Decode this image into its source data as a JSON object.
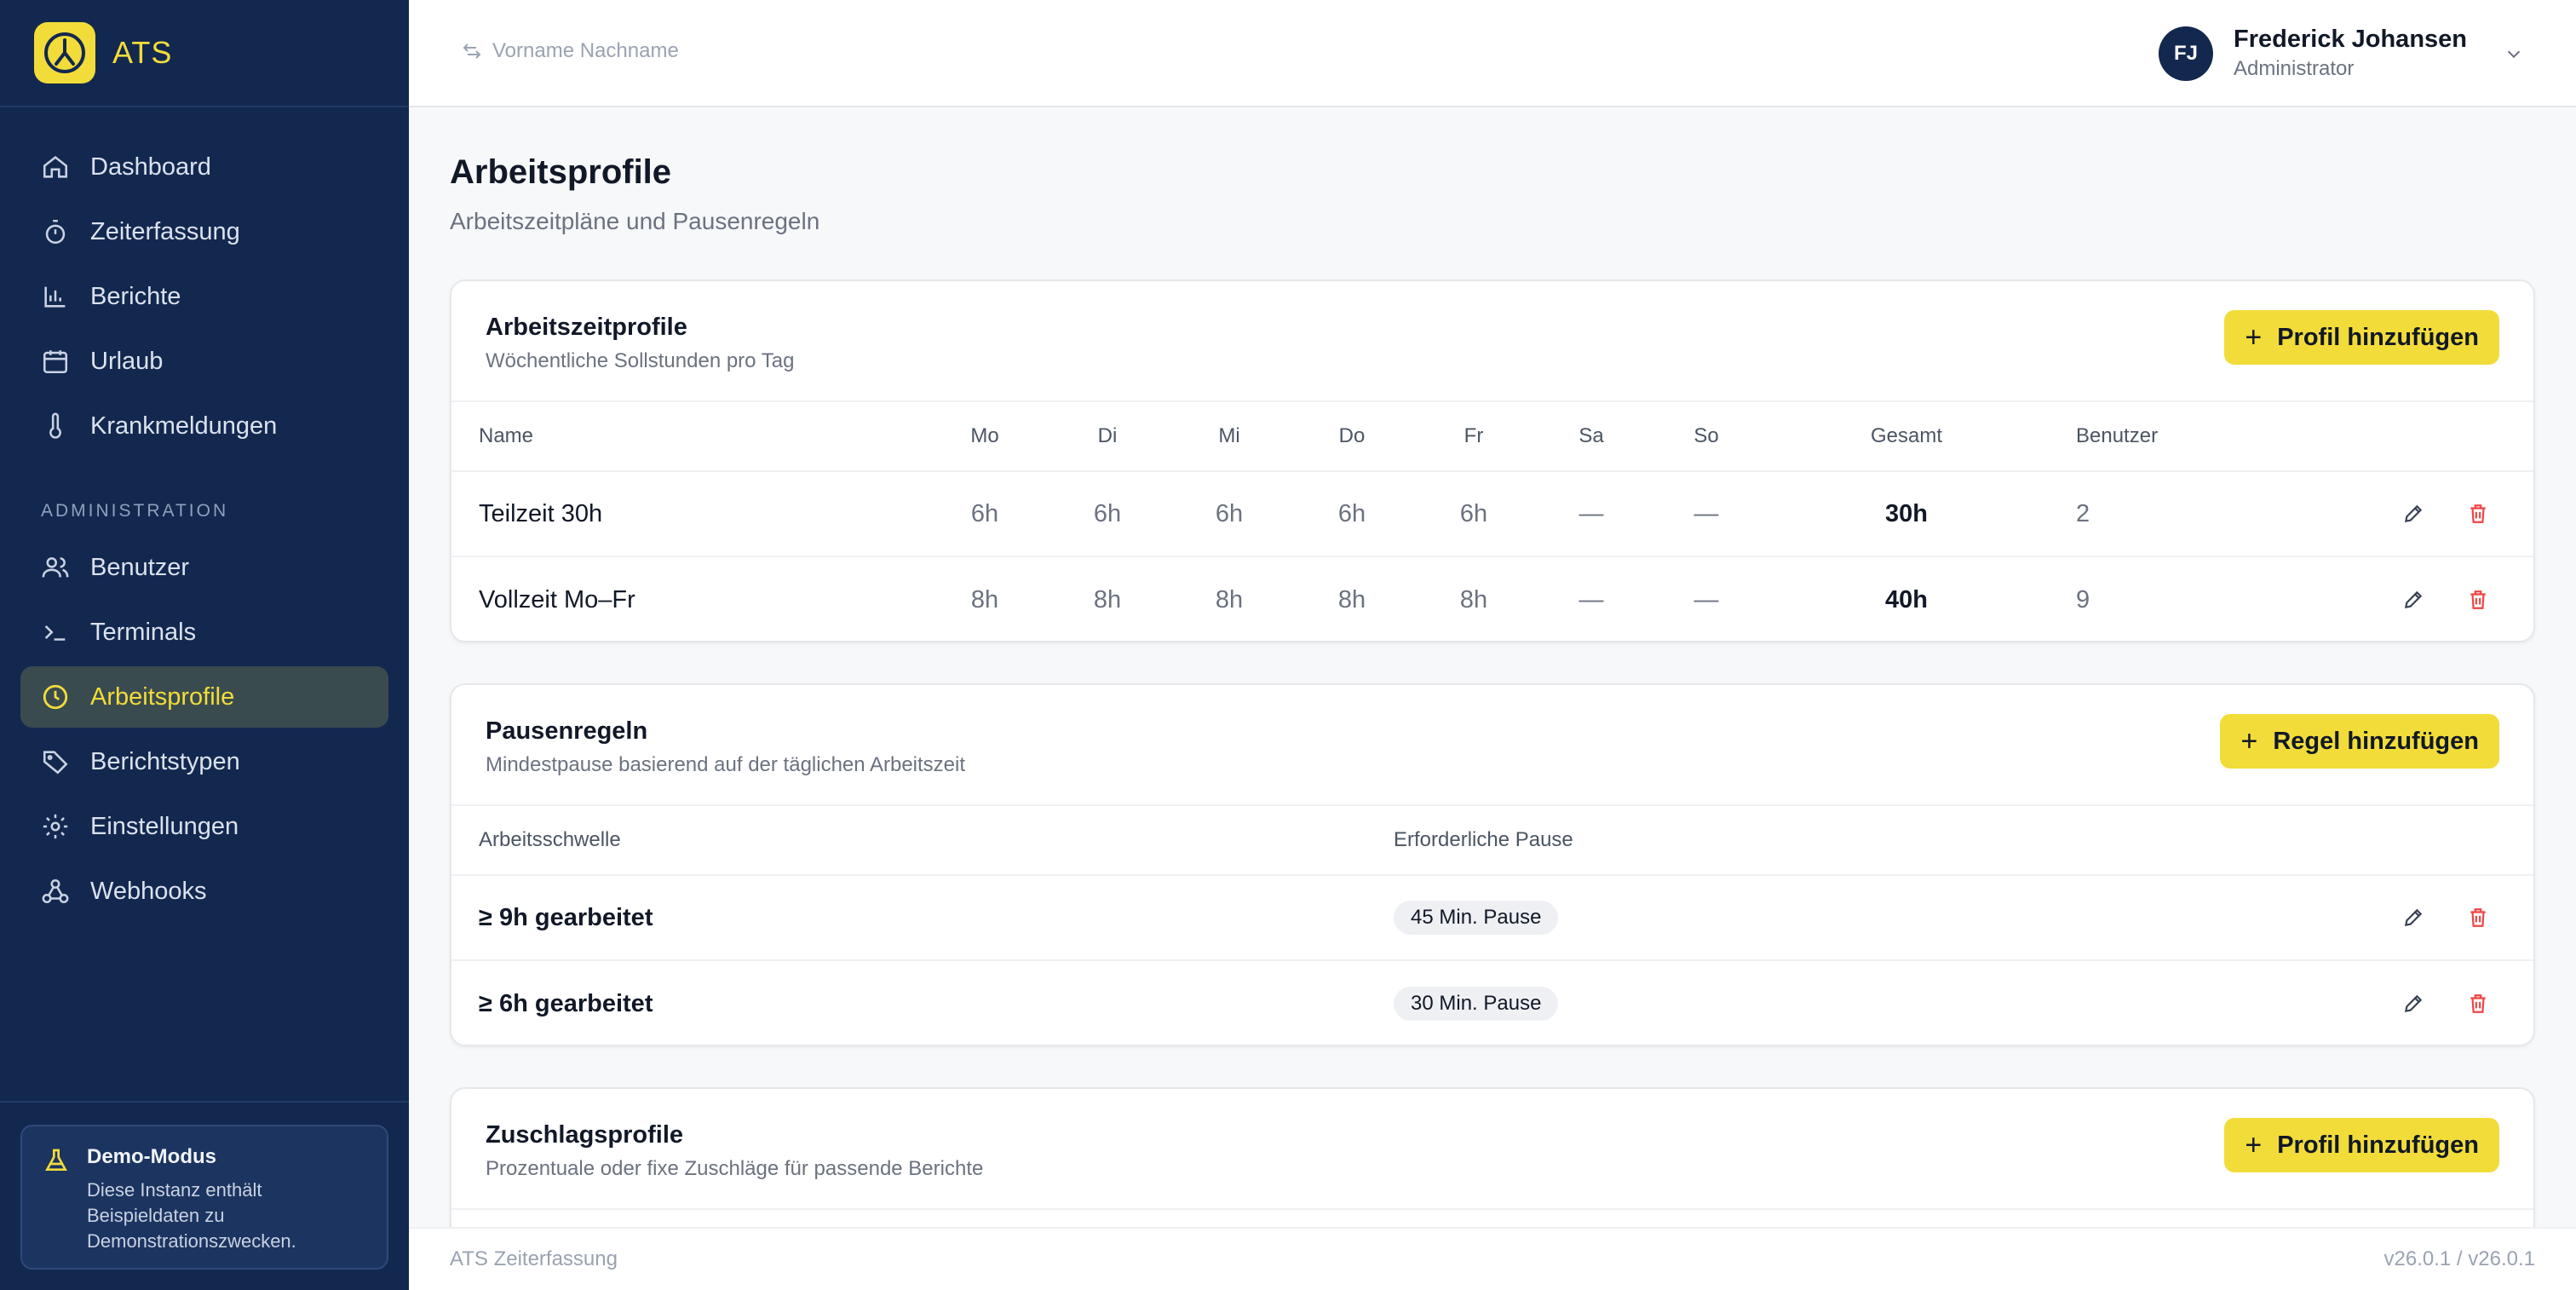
{
  "app": {
    "name": "ATS"
  },
  "sidebar": {
    "items": [
      {
        "label": "Dashboard",
        "icon": "home-icon"
      },
      {
        "label": "Zeiterfassung",
        "icon": "stopwatch-icon"
      },
      {
        "label": "Berichte",
        "icon": "bar-chart-icon"
      },
      {
        "label": "Urlaub",
        "icon": "calendar-icon"
      },
      {
        "label": "Krankmeldungen",
        "icon": "thermometer-icon"
      }
    ],
    "section_label": "ADMINISTRATION",
    "admin_items": [
      {
        "label": "Benutzer",
        "icon": "users-icon"
      },
      {
        "label": "Terminals",
        "icon": "terminal-icon"
      },
      {
        "label": "Arbeitsprofile",
        "icon": "clock-icon",
        "active": true
      },
      {
        "label": "Berichtstypen",
        "icon": "tag-icon"
      },
      {
        "label": "Einstellungen",
        "icon": "gear-icon"
      },
      {
        "label": "Webhooks",
        "icon": "webhook-icon"
      }
    ],
    "demo": {
      "title": "Demo-Modus",
      "text": "Diese Instanz enthält Beispieldaten zu Demonstrationszwecken."
    }
  },
  "topbar": {
    "search_placeholder": "Vorname Nachname",
    "user": {
      "initials": "FJ",
      "name": "Frederick Johansen",
      "role": "Administrator"
    }
  },
  "page": {
    "title": "Arbeitsprofile",
    "subtitle": "Arbeitszeitpläne und Pausenregeln"
  },
  "work_profiles": {
    "title": "Arbeitszeitprofile",
    "subtitle": "Wöchentliche Sollstunden pro Tag",
    "add_label": "Profil hinzufügen",
    "columns": {
      "name": "Name",
      "mo": "Mo",
      "di": "Di",
      "mi": "Mi",
      "do": "Do",
      "fr": "Fr",
      "sa": "Sa",
      "so": "So",
      "total": "Gesamt",
      "users": "Benutzer"
    },
    "rows": [
      {
        "name": "Teilzeit 30h",
        "mo": "6h",
        "di": "6h",
        "mi": "6h",
        "do": "6h",
        "fr": "6h",
        "sa": "—",
        "so": "—",
        "total": "30h",
        "users": "2"
      },
      {
        "name": "Vollzeit Mo–Fr",
        "mo": "8h",
        "di": "8h",
        "mi": "8h",
        "do": "8h",
        "fr": "8h",
        "sa": "—",
        "so": "—",
        "total": "40h",
        "users": "9"
      }
    ]
  },
  "break_rules": {
    "title": "Pausenregeln",
    "subtitle": "Mindestpause basierend auf der täglichen Arbeitszeit",
    "add_label": "Regel hinzufügen",
    "columns": {
      "threshold": "Arbeitsschwelle",
      "pause": "Erforderliche Pause"
    },
    "rows": [
      {
        "threshold": "≥ 9h gearbeitet",
        "pause": "45 Min. Pause"
      },
      {
        "threshold": "≥ 6h gearbeitet",
        "pause": "30 Min. Pause"
      }
    ]
  },
  "surcharge_profiles": {
    "title": "Zuschlagsprofile",
    "subtitle": "Prozentuale oder fixe Zuschläge für passende Berichte",
    "add_label": "Profil hinzufügen"
  },
  "footer": {
    "left": "ATS Zeiterfassung",
    "right": "v26.0.1 / v26.0.1"
  },
  "colors": {
    "sidebar_bg": "#13284f",
    "accent": "#f2dc3a",
    "danger": "#ef4444"
  }
}
